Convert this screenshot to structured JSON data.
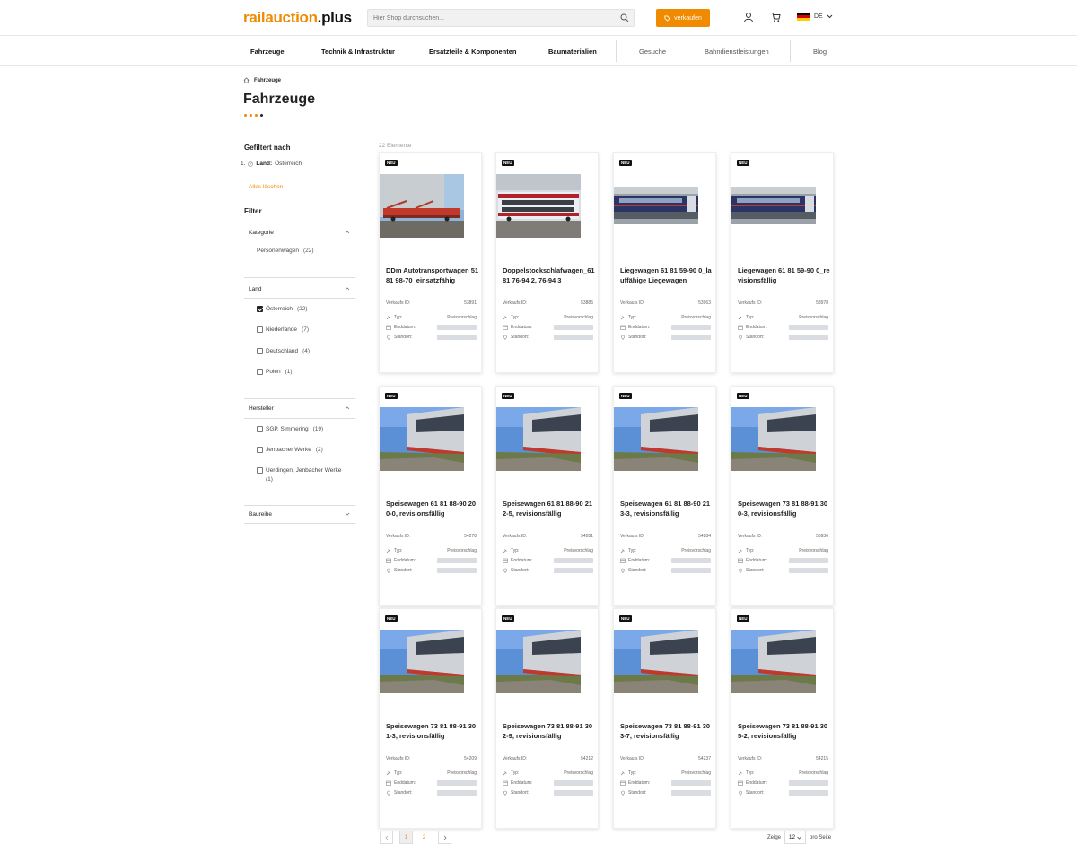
{
  "header": {
    "logo_part1": "railauction",
    "logo_part2": ".plus",
    "search_placeholder": "Hier Shop durchsuchen...",
    "sell_label": "verkaufen",
    "lang_label": "DE"
  },
  "nav": {
    "items": [
      "Fahrzeuge",
      "Technik & Infrastruktur",
      "Ersatzteile & Komponenten",
      "Baumaterialien",
      "Gesuche",
      "Bahndienstleistungen",
      "Blog"
    ]
  },
  "breadcrumb": {
    "current": "Fahrzeuge"
  },
  "page_title": "Fahrzeuge",
  "sidebar": {
    "filtered_by": "Gefiltert nach",
    "active_filter_index": "1.",
    "active_filter_label": "Land:",
    "active_filter_value": "Österreich",
    "clear_all": "Alles löschen",
    "filter_heading": "Filter",
    "facets": [
      {
        "title": "Kategorie",
        "options": [
          {
            "label": "Personenwagen",
            "count": "(22)"
          }
        ]
      },
      {
        "title": "Land",
        "options": [
          {
            "label": "Österreich",
            "count": "(22)",
            "checked": true
          },
          {
            "label": "Niederlande",
            "count": "(7)"
          },
          {
            "label": "Deutschland",
            "count": "(4)"
          },
          {
            "label": "Polen",
            "count": "(1)"
          }
        ]
      },
      {
        "title": "Hersteller",
        "options": [
          {
            "label": "SGP, Simmering",
            "count": "(19)"
          },
          {
            "label": "Jenbacher Werke",
            "count": "(2)"
          },
          {
            "label": "Uerdingen, Jenbacher Werke",
            "count": "(1)"
          }
        ]
      },
      {
        "title": "Baureihe",
        "options": []
      }
    ]
  },
  "results_count": "22 Elemente",
  "labels": {
    "new_badge": "NEU",
    "sale_id": "Verkaufs ID:",
    "type": "Typ:",
    "end_date": "Enddatum:",
    "location": "Standort:"
  },
  "products": [
    {
      "title": "DDm Autotransportwagen 51 81 98-70_einsatzfähig",
      "id": "53891",
      "type": "Preisvorschlag",
      "image": "car-transporter"
    },
    {
      "title": "Doppelstockschlafwagen_61 81 76-94 2, 76-94 3",
      "id": "53885",
      "type": "Preisvorschlag",
      "image": "double-deck"
    },
    {
      "title": "Liegewagen 61 81 59-90 0_lauffähige Liegewagen",
      "id": "53963",
      "type": "Preisvorschlag",
      "image": "couchette"
    },
    {
      "title": "Liegewagen 61 81 59-90 0_revisionsfällig",
      "id": "53978",
      "type": "Preisvorschlag",
      "image": "couchette"
    },
    {
      "title": "Speisewagen 61 81 88-90 200-0, revisionsfällig",
      "id": "54278",
      "type": "Preisvorschlag",
      "image": "dining"
    },
    {
      "title": "Speisewagen 61 81 88-90 212-5, revisionsfällig",
      "id": "54281",
      "type": "Preisvorschlag",
      "image": "dining"
    },
    {
      "title": "Speisewagen 61 81 88-90 213-3, revisionsfällig",
      "id": "54284",
      "type": "Preisvorschlag",
      "image": "dining"
    },
    {
      "title": "Speisewagen 73 81 88-91 300-3, revisionsfällig",
      "id": "53936",
      "type": "Preisvorschlag",
      "image": "dining"
    },
    {
      "title": "Speisewagen 73 81 88-91 301-3, revisionsfällig",
      "id": "54209",
      "type": "Preisvorschlag",
      "image": "dining"
    },
    {
      "title": "Speisewagen 73 81 88-91 302-9, revisionsfällig",
      "id": "54212",
      "type": "Preisvorschlag",
      "image": "dining"
    },
    {
      "title": "Speisewagen 73 81 88-91 303-7, revisionsfällig",
      "id": "54237",
      "type": "Preisvorschlag",
      "image": "dining"
    },
    {
      "title": "Speisewagen 73 81 88-91 305-2, revisionsfällig",
      "id": "54215",
      "type": "Preisvorschlag",
      "image": "dining"
    }
  ],
  "pagination": {
    "pages": [
      "1",
      "2"
    ],
    "current": "1"
  },
  "per_page": {
    "prefix": "Zeige",
    "value": "12",
    "suffix": "pro Seite"
  },
  "colors": {
    "accent": "#f08a00",
    "text": "#222222"
  }
}
